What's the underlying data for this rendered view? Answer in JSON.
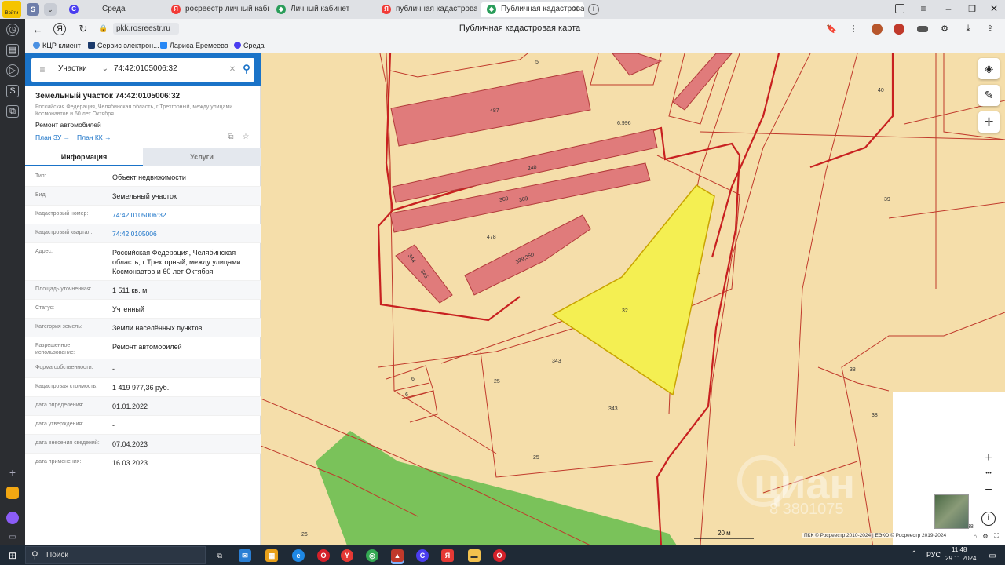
{
  "browser": {
    "tabs": [
      {
        "label": "Среда",
        "icon": "C",
        "color": "#4a3df0"
      },
      {
        "label": "росреестр личный кабинет",
        "icon": "Я",
        "color": "#f23a36"
      },
      {
        "label": "Личный кабинет",
        "icon": "◆",
        "color": "#2a9d5a"
      },
      {
        "label": "публичная кадастровая",
        "icon": "Я",
        "color": "#f23a36"
      },
      {
        "label": "Публичная кадастровая",
        "icon": "◆",
        "color": "#2a9d5a"
      }
    ],
    "new_tab": "+",
    "profile_label": "Войти",
    "url": "pkk.rosreestr.ru",
    "page_title": "Публичная кадастровая карта",
    "bookmarks": [
      "КЦР клиент",
      "Сервис электрон...",
      "Лариса Еремеева",
      "Среда"
    ]
  },
  "panel": {
    "search_mode": "Участки",
    "search_value": "74:42:0105006:32",
    "object_title": "Земельный участок 74:42:0105006:32",
    "object_address_short": "Российская Федерация, Челябинская область, г Трехгорный, между улицами Космонавтов и 60 лет Октября",
    "object_use": "Ремонт автомобилей",
    "link_plan_zu": "План ЗУ →",
    "link_plan_kk": "План КК →",
    "tab_info": "Информация",
    "tab_services": "Услуги",
    "rows": [
      {
        "label": "Тип:",
        "value": "Объект недвижимости"
      },
      {
        "label": "Вид:",
        "value": "Земельный участок"
      },
      {
        "label": "Кадастровый номер:",
        "value": "74:42:0105006:32"
      },
      {
        "label": "Кадастровый квартал:",
        "value": "74:42:0105006"
      },
      {
        "label": "Адрес:",
        "value": "Российская Федерация, Челябинская область, г Трехгорный, между улицами Космонавтов и 60 лет Октября"
      },
      {
        "label": "Площадь уточненная:",
        "value": "1 511 кв. м"
      },
      {
        "label": "Статус:",
        "value": "Учтенный"
      },
      {
        "label": "Категория земель:",
        "value": "Земли населённых пунктов"
      },
      {
        "label": "Разрешенное использование:",
        "value": "Ремонт автомобилей"
      },
      {
        "label": "Форма собственности:",
        "value": "-"
      },
      {
        "label": "Кадастровая стоимость:",
        "value": "1 419 977,36 руб."
      },
      {
        "label": "дата определения:",
        "value": "01.01.2022"
      },
      {
        "label": "дата утверждения:",
        "value": "-"
      },
      {
        "label": "дата внесения сведений:",
        "value": "07.04.2023"
      },
      {
        "label": "дата применения:",
        "value": "16.03.2023"
      }
    ]
  },
  "map": {
    "labels": [
      "5",
      "487",
      "6.996",
      "240",
      "360",
      "369",
      "478",
      "344",
      "345",
      "339,350",
      "32",
      "343",
      "6",
      "6",
      "25",
      "343",
      "25",
      "26",
      "40",
      "39",
      "38",
      "38",
      "38"
    ],
    "scale_label": "20 м",
    "copyright": "ПКК © Росреестр 2010-2024 | ЕЭКО © Росреестр 2019-2024",
    "watermark": "циан",
    "watermark_phone": "8 3801075",
    "zoom_in": "+",
    "zoom_out": "−",
    "more": "•••",
    "info": "i"
  },
  "taskbar": {
    "search_label": "Поиск",
    "lang": "РУС",
    "time": "11:48",
    "date": "29.11.2024"
  }
}
